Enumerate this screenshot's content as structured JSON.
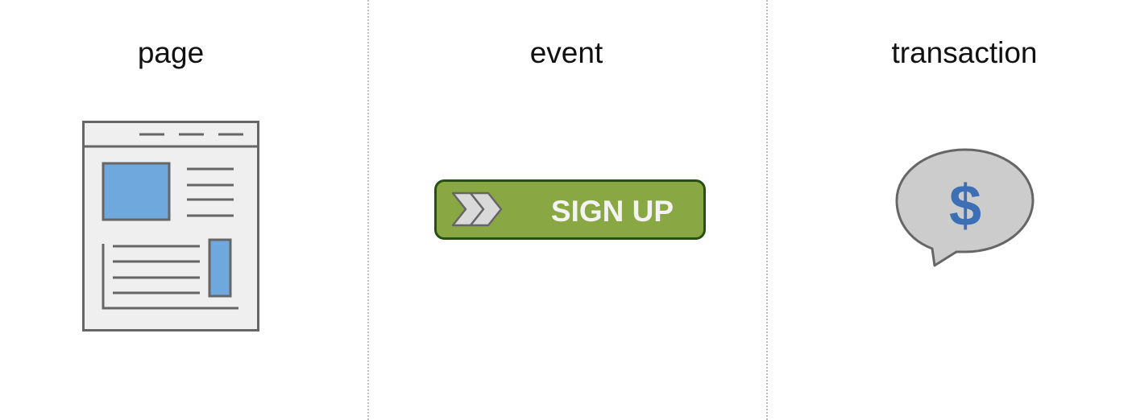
{
  "columns": [
    {
      "title": "page",
      "icon": "web-page-icon"
    },
    {
      "title": "event",
      "icon": "sign-up-button-icon"
    },
    {
      "title": "transaction",
      "icon": "dollar-speech-bubble-icon"
    }
  ],
  "event_button": {
    "label": "SIGN UP",
    "icon": "double-chevron-icon"
  },
  "transaction_symbol": "$",
  "colors": {
    "outline": "#666666",
    "page_fill": "#efefef",
    "accent_blue": "#6fa8dc",
    "button_green": "#89a843",
    "button_border": "#274e13",
    "button_text": "#f3f3f3",
    "bubble_fill": "#cccccc",
    "dollar_blue": "#3d6fb5",
    "divider": "#bdbdbd"
  }
}
